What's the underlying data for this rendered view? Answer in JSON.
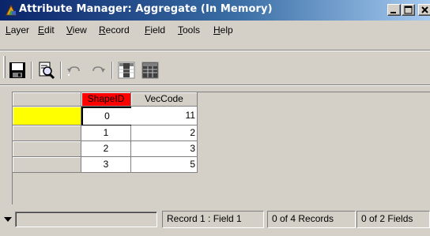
{
  "window": {
    "title": "Attribute Manager: Aggregate (In Memory)",
    "buttons": {
      "minimize": "_",
      "maximize": "□",
      "close": "X"
    }
  },
  "menu": {
    "items": [
      {
        "label": "Layer",
        "underline": "L"
      },
      {
        "label": "Edit",
        "underline": "E"
      },
      {
        "label": "View",
        "underline": "V"
      },
      {
        "label": "Record",
        "underline": "R"
      },
      {
        "label": "Field",
        "underline": "F"
      },
      {
        "label": "Tools",
        "underline": "T"
      },
      {
        "label": "Help",
        "underline": "H"
      }
    ]
  },
  "toolbar": {
    "tools": [
      "save-icon",
      "find-icon",
      "undo-icon",
      "redo-icon",
      "select-column-icon",
      "select-all-icon"
    ]
  },
  "grid": {
    "columns": [
      "ShapeID",
      "VecCode"
    ],
    "selected_column": "ShapeID",
    "rows": [
      {
        "shape_id": "0",
        "vec_code": "11"
      },
      {
        "shape_id": "1",
        "vec_code": "2"
      },
      {
        "shape_id": "2",
        "vec_code": "3"
      },
      {
        "shape_id": "3",
        "vec_code": "5"
      }
    ]
  },
  "status": {
    "position": "Record 1 : Field 1",
    "records": "0 of 4 Records",
    "fields": "0 of 2 Fields"
  },
  "colors": {
    "title_gradient_start": "#0a246a",
    "title_gradient_end": "#a6caf0",
    "selected_header": "#ff0000",
    "active_row_header": "#ffff00",
    "face": "#d4d0c8"
  }
}
